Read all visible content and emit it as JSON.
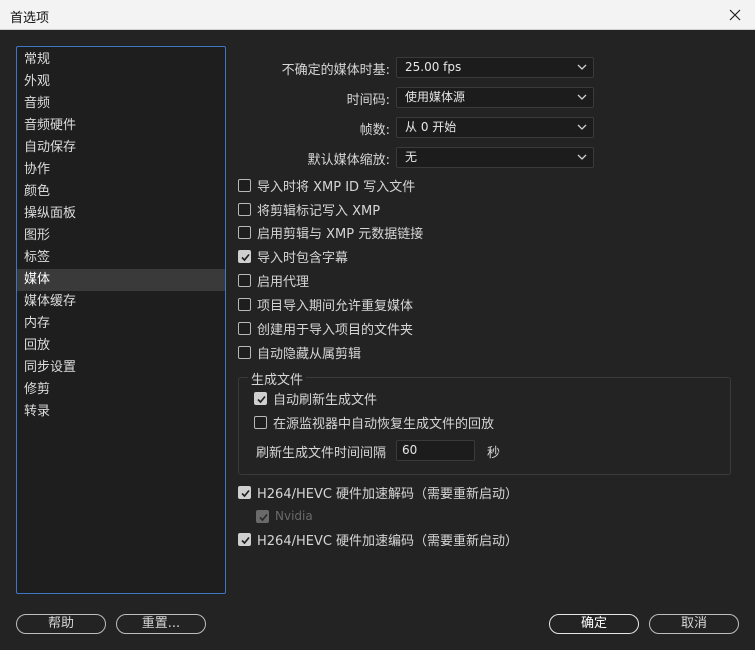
{
  "window": {
    "title": "首选项"
  },
  "sidebar": {
    "items": [
      {
        "label": "常规"
      },
      {
        "label": "外观"
      },
      {
        "label": "音频"
      },
      {
        "label": "音频硬件"
      },
      {
        "label": "自动保存"
      },
      {
        "label": "协作"
      },
      {
        "label": "颜色"
      },
      {
        "label": "操纵面板"
      },
      {
        "label": "图形"
      },
      {
        "label": "标签"
      },
      {
        "label": "媒体"
      },
      {
        "label": "媒体缓存"
      },
      {
        "label": "内存"
      },
      {
        "label": "回放"
      },
      {
        "label": "同步设置"
      },
      {
        "label": "修剪"
      },
      {
        "label": "转录"
      }
    ],
    "selected": "媒体"
  },
  "fields": {
    "indeterminate_timebase": {
      "label": "不确定的媒体时基:",
      "value": "25.00 fps"
    },
    "timecode": {
      "label": "时间码:",
      "value": "使用媒体源"
    },
    "frame_count": {
      "label": "帧数:",
      "value": "从 0 开始"
    },
    "default_scaling": {
      "label": "默认媒体缩放:",
      "value": "无"
    }
  },
  "checkboxes": {
    "write_xmp_on_import": {
      "label": "导入时将 XMP ID 写入文件",
      "checked": false
    },
    "write_clip_markers_xmp": {
      "label": "将剪辑标记写入 XMP",
      "checked": false
    },
    "enable_clip_xmp_link": {
      "label": "启用剪辑与 XMP 元数据链接",
      "checked": false
    },
    "include_captions": {
      "label": "导入时包含字幕",
      "checked": true
    },
    "enable_proxies": {
      "label": "启用代理",
      "checked": false
    },
    "allow_duplicate_media": {
      "label": "项目导入期间允许重复媒体",
      "checked": false
    },
    "create_folder_import": {
      "label": "创建用于导入项目的文件夹",
      "checked": false
    },
    "auto_hide_subclips": {
      "label": "自动隐藏从属剪辑",
      "checked": false
    }
  },
  "growing_files": {
    "title": "生成文件",
    "auto_refresh": {
      "label": "自动刷新生成文件",
      "checked": true
    },
    "auto_resume": {
      "label": "在源监视器中自动恢复生成文件的回放",
      "checked": false
    },
    "refresh_interval": {
      "label": "刷新生成文件时间间隔",
      "value": "60",
      "unit": "秒"
    }
  },
  "hardware": {
    "decode": {
      "label": "H264/HEVC 硬件加速解码（需要重新启动）",
      "checked": true
    },
    "nvidia": {
      "label": "Nvidia",
      "checked": true,
      "disabled": true
    },
    "encode": {
      "label": "H264/HEVC 硬件加速编码（需要重新启动）",
      "checked": true
    }
  },
  "buttons": {
    "help": "帮助",
    "reset": "重置...",
    "ok": "确定",
    "cancel": "取消"
  }
}
